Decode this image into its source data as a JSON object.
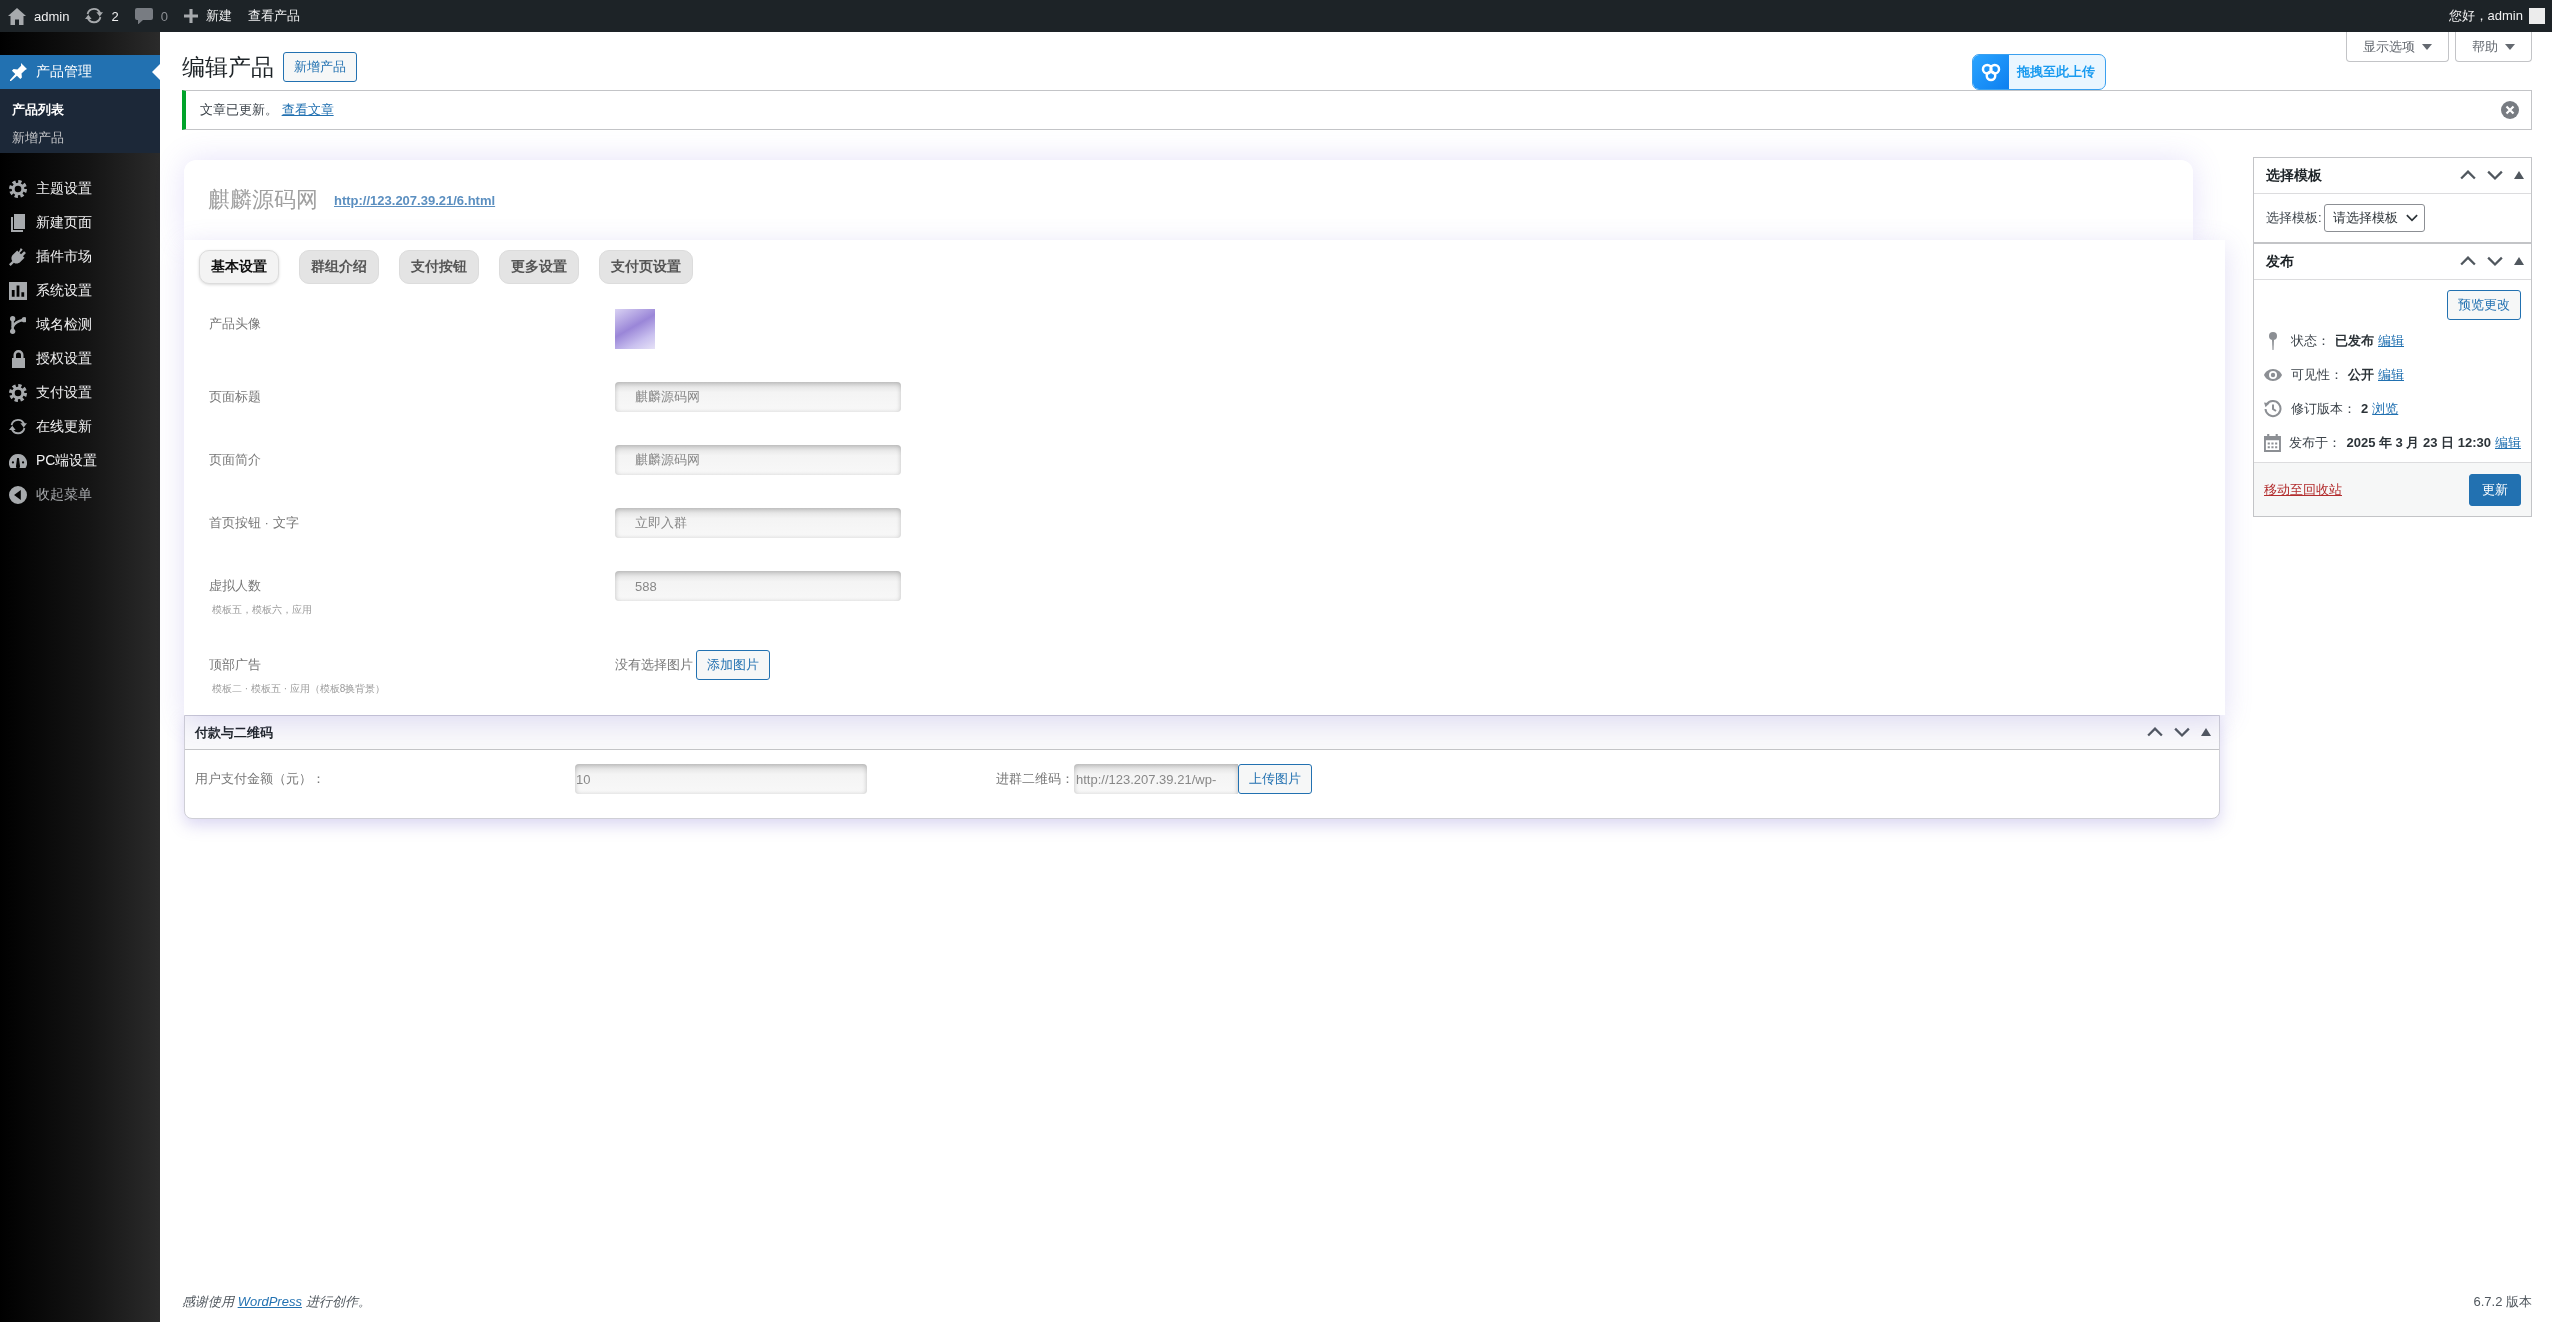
{
  "admin_bar": {
    "items": [
      {
        "label": "admin",
        "dimmed": false
      },
      {
        "label": "2",
        "dimmed": false
      },
      {
        "label": "0",
        "dimmed": true
      },
      {
        "label": "新建",
        "dimmed": false
      },
      {
        "label": "查看产品",
        "dimmed": false
      }
    ],
    "greeting": "您好，admin"
  },
  "sidebar": {
    "items": [
      {
        "label": "产品管理",
        "kind": "menu",
        "selected": true,
        "children": [
          {
            "label": "产品列表",
            "selected": true
          },
          {
            "label": "新增产品",
            "selected": false
          }
        ]
      },
      {
        "label": "主题设置",
        "kind": "menu",
        "selected": false
      },
      {
        "label": "新建页面",
        "kind": "menu",
        "selected": false
      },
      {
        "label": "插件市场",
        "kind": "menu",
        "selected": false
      },
      {
        "label": "系统设置",
        "kind": "menu",
        "selected": false
      },
      {
        "label": "域名检测",
        "kind": "menu",
        "selected": false
      },
      {
        "label": "授权设置",
        "kind": "menu",
        "selected": false
      },
      {
        "label": "支付设置",
        "kind": "menu",
        "selected": false
      },
      {
        "label": "在线更新",
        "kind": "menu",
        "selected": false
      },
      {
        "label": "PC端设置",
        "kind": "menu",
        "selected": false
      },
      {
        "label": "收起菜单",
        "kind": "collapse",
        "selected": false
      }
    ]
  },
  "screen_options": [
    {
      "label": "显示选项"
    },
    {
      "label": "帮助"
    }
  ],
  "header": {
    "title": "编辑产品",
    "button": "新增产品"
  },
  "upload_badge": {
    "label": "拖拽至此上传"
  },
  "notice": {
    "text": "文章已更新。",
    "link": "查看文章"
  },
  "title_card": {
    "value": "麒麟源码网",
    "permalink": "http://123.207.39.21/6.html"
  },
  "settings": {
    "tabs": [
      {
        "label": "基本设置",
        "selected": true
      },
      {
        "label": "群组介绍",
        "selected": false
      },
      {
        "label": "支付按钮",
        "selected": false
      },
      {
        "label": "更多设置",
        "selected": false
      },
      {
        "label": "支付页设置",
        "selected": false
      }
    ],
    "rows": [
      {
        "kind": "image",
        "label": "产品头像"
      },
      {
        "kind": "text",
        "label": "页面标题",
        "value": "麒麟源码网"
      },
      {
        "kind": "text",
        "label": "页面简介",
        "value": "麒麟源码网"
      },
      {
        "kind": "text",
        "label": "首页按钮 · 文字",
        "value": "立即入群"
      },
      {
        "kind": "text",
        "label": "虚拟人数",
        "value": "588",
        "hint": "模板五，模板六，应用"
      },
      {
        "kind": "media",
        "label": "顶部广告",
        "hint": "模板二 · 模板五 · 应用（模板8换背景）",
        "status": "没有选择图片",
        "button": "添加图片"
      }
    ]
  },
  "payment": {
    "title": "付款与二维码",
    "fields": [
      {
        "kind": "text",
        "label": "用户支付金额（元）：",
        "value": "10"
      },
      {
        "kind": "upload",
        "label": "进群二维码：",
        "value": "http://123.207.39.21/wp-",
        "button": "上传图片"
      }
    ]
  },
  "template_box": {
    "title": "选择模板",
    "label": "选择模板:",
    "select": "请选择模板"
  },
  "publish_box": {
    "title": "发布",
    "preview": "预览更改",
    "rows": [
      {
        "label": "状态：",
        "value": "已发布",
        "link": "编辑"
      },
      {
        "label": "可见性：",
        "value": "公开",
        "link": "编辑"
      },
      {
        "label": "修订版本：",
        "value": "2",
        "link": "浏览"
      },
      {
        "label": "发布于：",
        "value": "2025 年 3 月 23 日 12:30",
        "link": "编辑"
      }
    ],
    "trash": "移动至回收站",
    "update": "更新"
  },
  "footer": {
    "before": "感谢使用 ",
    "link": "WordPress",
    "after": " 进行创作。",
    "version": "6.7.2 版本"
  }
}
